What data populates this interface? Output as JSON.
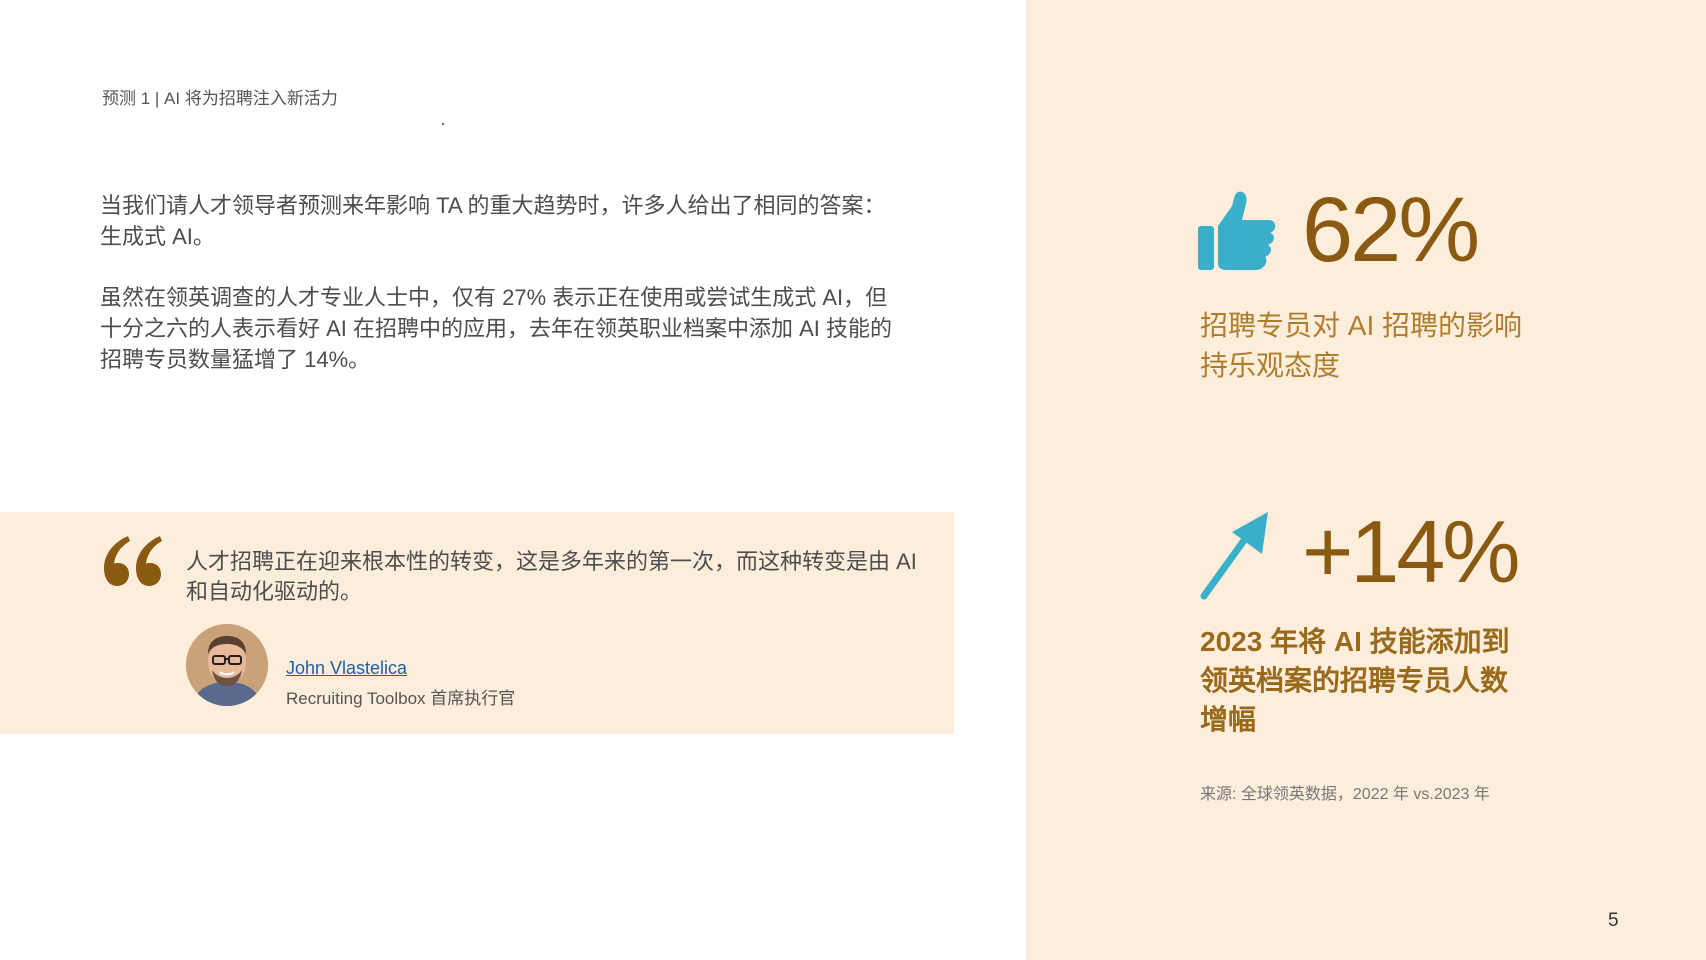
{
  "header": {
    "section_label": "预测 1 | AI 将为招聘注入新活力"
  },
  "intro": {
    "paragraph_1": "当我们请人才领导者预测来年影响 TA 的重大趋势时，许多人给出了相同的答案：生成式 AI。",
    "paragraph_2": "虽然在领英调查的人才专业人士中，仅有 27% 表示正在使用或尝试生成式 AI，但十分之六的人表示看好 AI 在招聘中的应用，去年在领英职业档案中添加 AI 技能的招聘专员数量猛增了 14%。"
  },
  "quote": {
    "text": "人才招聘正在迎来根本性的转变，这是多年来的第一次，而这种转变是由 AI 和自动化驱动的。",
    "author_name": "John Vlastelica",
    "author_title": "Recruiting Toolbox 首席执行官"
  },
  "stats": {
    "stat1": {
      "icon": "thumbs-up-icon",
      "value": "62%",
      "description": "招聘专员对 AI 招聘的影响持乐观态度"
    },
    "stat2": {
      "icon": "arrow-up-right-icon",
      "value": "+14%",
      "description": "2023 年将 AI 技能添加到领英档案的招聘专员人数增幅"
    },
    "source": "来源: 全球领英数据，2022 年 vs.2023 年"
  },
  "page_number": "5",
  "colors": {
    "panel_background": "#fdeedc",
    "accent_brown": "#8a5a12",
    "icon_teal": "#3aafc9",
    "link_blue": "#1f5ea8"
  }
}
